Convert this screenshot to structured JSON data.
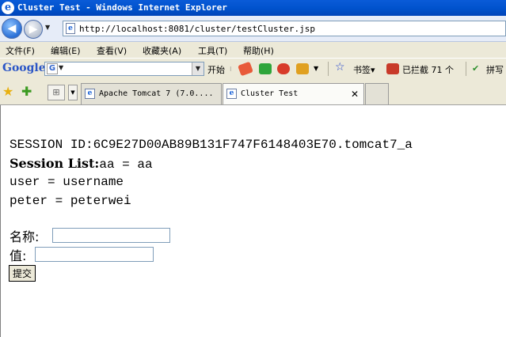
{
  "window": {
    "title": "Cluster Test - Windows Internet Explorer"
  },
  "address_bar": {
    "url": "http://localhost:8081/cluster/testCluster.jsp"
  },
  "menu": [
    "文件(F)",
    "编辑(E)",
    "查看(V)",
    "收藏夹(A)",
    "工具(T)",
    "帮助(H)"
  ],
  "google_toolbar": {
    "logo": "Google",
    "start_label": "开始",
    "bookmarks_label": "书签▾",
    "blocked_label": "已拦截 71 个",
    "spell_label": "拼写"
  },
  "tabs": [
    {
      "title": "Apache Tomcat 7 (7.0....",
      "active": false
    },
    {
      "title": "Cluster Test",
      "active": true
    }
  ],
  "page": {
    "session_id": "SESSION ID:6C9E27D00AB89B131F747F6148403E70.tomcat7_a",
    "session_list_label": "Session List:",
    "session_entries": [
      "aa = aa",
      "user = username",
      "peter = peterwei"
    ],
    "form": {
      "name_label": "名称:",
      "name_value": "",
      "value_label": "值:",
      "value_value": "",
      "submit_label": "提交"
    }
  },
  "colors": {
    "title_bar": "#0054e3",
    "chrome": "#ece9d8",
    "address_bg": "#e6ecf8"
  }
}
